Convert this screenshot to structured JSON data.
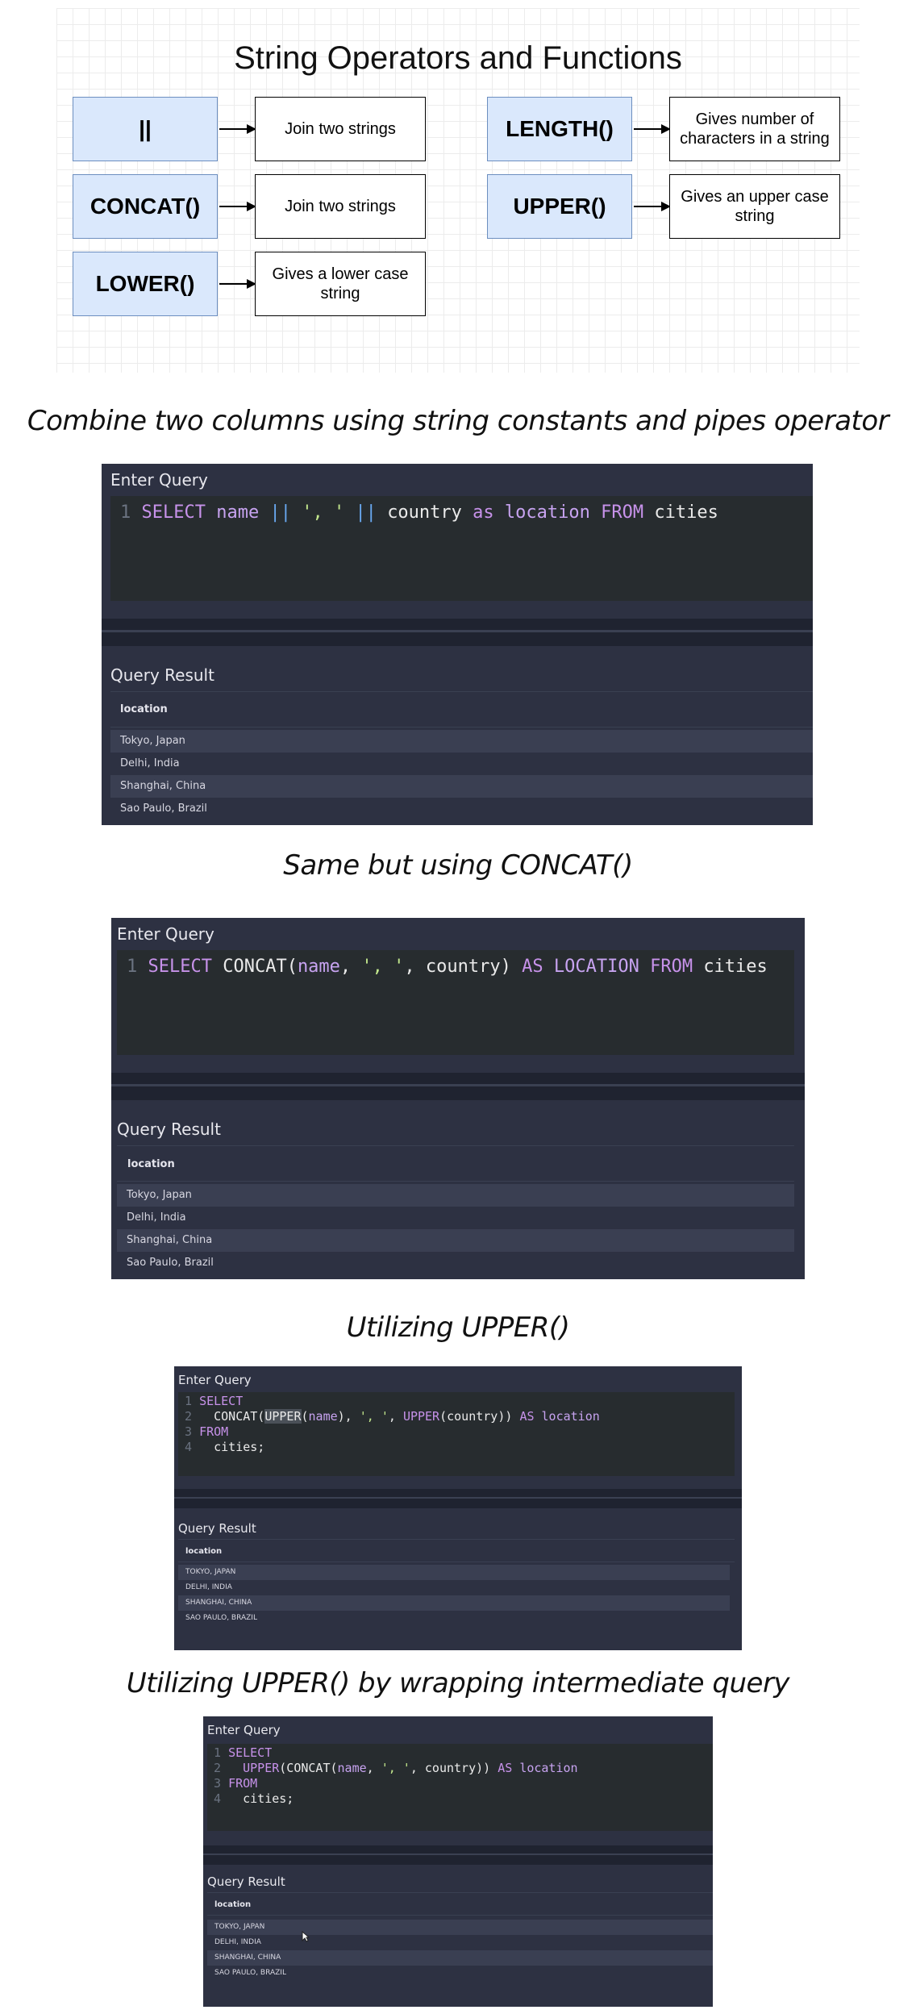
{
  "diagram": {
    "title": "String Operators and Functions",
    "items": [
      {
        "fn": "||",
        "desc": "Join two strings"
      },
      {
        "fn": "CONCAT()",
        "desc": "Join two strings"
      },
      {
        "fn": "LOWER()",
        "desc": "Gives a lower case string"
      },
      {
        "fn": "LENGTH()",
        "desc": "Gives number of characters in a string"
      },
      {
        "fn": "UPPER()",
        "desc": "Gives an upper case string"
      }
    ]
  },
  "sections": [
    {
      "heading": "Combine two columns using string constants and pipes operator",
      "enter_query_label": "Enter Query",
      "query_result_label": "Query Result",
      "column_header": "location",
      "code": [
        {
          "num": "1",
          "tokens": [
            {
              "t": "SELECT ",
              "c": "kw"
            },
            {
              "t": "name ",
              "c": "id"
            },
            {
              "t": "|| ",
              "c": "pipe"
            },
            {
              "t": "', ' ",
              "c": "str"
            },
            {
              "t": "|| ",
              "c": "pipe"
            },
            {
              "t": "country ",
              "c": ""
            },
            {
              "t": "as ",
              "c": "kw"
            },
            {
              "t": "location ",
              "c": "id"
            },
            {
              "t": "FROM ",
              "c": "kw"
            },
            {
              "t": "cities",
              "c": ""
            }
          ]
        }
      ],
      "rows": [
        "Tokyo, Japan",
        "Delhi, India",
        "Shanghai, China",
        "Sao Paulo, Brazil"
      ]
    },
    {
      "heading": "Same but using CONCAT()",
      "enter_query_label": "Enter Query",
      "query_result_label": "Query Result",
      "column_header": "location",
      "code": [
        {
          "num": "1",
          "tokens": [
            {
              "t": "SELECT ",
              "c": "kw"
            },
            {
              "t": "CONCAT(",
              "c": ""
            },
            {
              "t": "name",
              "c": "id"
            },
            {
              "t": ", ",
              "c": ""
            },
            {
              "t": "', '",
              "c": "str"
            },
            {
              "t": ", country) ",
              "c": ""
            },
            {
              "t": "AS ",
              "c": "kw"
            },
            {
              "t": "LOCATION ",
              "c": "id"
            },
            {
              "t": "FROM ",
              "c": "kw"
            },
            {
              "t": "cities",
              "c": ""
            }
          ]
        }
      ],
      "rows": [
        "Tokyo, Japan",
        "Delhi, India",
        "Shanghai, China",
        "Sao Paulo, Brazil"
      ]
    },
    {
      "heading": "Utilizing UPPER()",
      "enter_query_label": "Enter Query",
      "query_result_label": "Query Result",
      "column_header": "location",
      "code": [
        {
          "num": "1",
          "tokens": [
            {
              "t": "SELECT",
              "c": "kw"
            }
          ]
        },
        {
          "num": "2",
          "tokens": [
            {
              "t": "  CONCAT(",
              "c": ""
            },
            {
              "t": "UPPER",
              "c": "hl"
            },
            {
              "t": "(",
              "c": ""
            },
            {
              "t": "name",
              "c": "id"
            },
            {
              "t": "), ",
              "c": ""
            },
            {
              "t": "', '",
              "c": "str"
            },
            {
              "t": ", ",
              "c": ""
            },
            {
              "t": "UPPER",
              "c": "kw"
            },
            {
              "t": "(country)) ",
              "c": ""
            },
            {
              "t": "AS ",
              "c": "kw"
            },
            {
              "t": "location",
              "c": "id"
            }
          ]
        },
        {
          "num": "3",
          "tokens": [
            {
              "t": "FROM",
              "c": "kw"
            }
          ]
        },
        {
          "num": "4",
          "tokens": [
            {
              "t": "  cities;",
              "c": ""
            }
          ]
        }
      ],
      "rows": [
        "TOKYO, JAPAN",
        "DELHI, INDIA",
        "SHANGHAI, CHINA",
        "SAO PAULO, BRAZIL"
      ]
    },
    {
      "heading": "Utilizing UPPER() by wrapping intermediate query",
      "enter_query_label": "Enter Query",
      "query_result_label": "Query Result",
      "column_header": "location",
      "code": [
        {
          "num": "1",
          "tokens": [
            {
              "t": "SELECT",
              "c": "kw"
            }
          ]
        },
        {
          "num": "2",
          "tokens": [
            {
              "t": "  ",
              "c": ""
            },
            {
              "t": "UPPER",
              "c": "kw"
            },
            {
              "t": "(CONCAT(",
              "c": ""
            },
            {
              "t": "name",
              "c": "id"
            },
            {
              "t": ", ",
              "c": ""
            },
            {
              "t": "', '",
              "c": "str"
            },
            {
              "t": ", country)) ",
              "c": ""
            },
            {
              "t": "AS ",
              "c": "kw"
            },
            {
              "t": "location",
              "c": "id"
            }
          ]
        },
        {
          "num": "3",
          "tokens": [
            {
              "t": "FROM",
              "c": "kw"
            }
          ]
        },
        {
          "num": "4",
          "tokens": [
            {
              "t": "  cities;",
              "c": ""
            }
          ]
        }
      ],
      "rows": [
        "TOKYO, JAPAN",
        "DELHI, INDIA",
        "SHANGHAI, CHINA",
        "SAO PAULO, BRAZIL"
      ]
    }
  ]
}
